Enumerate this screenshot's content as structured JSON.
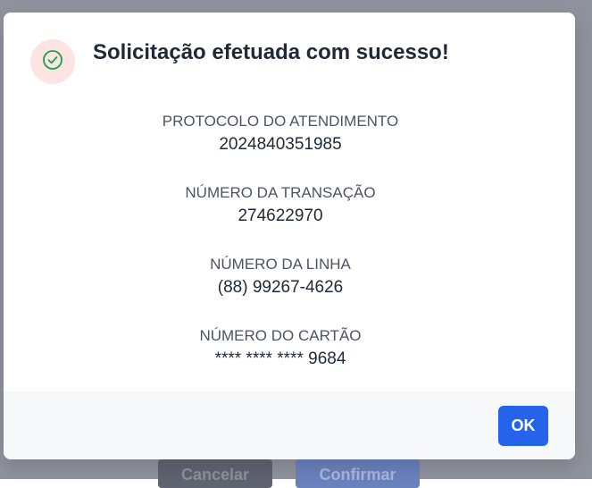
{
  "background": {
    "cancel_label": "Cancelar",
    "confirm_label": "Confirmar"
  },
  "dialog": {
    "icon": "check-circle-icon",
    "title": "Solicitação efetuada com sucesso!",
    "fields": [
      {
        "label": "PROTOCOLO DO ATENDIMENTO",
        "value": "2024840351985"
      },
      {
        "label": "NÚMERO DA TRANSAÇÃO",
        "value": "274622970"
      },
      {
        "label": "NÚMERO DA LINHA",
        "value": "(88) 99267-4626"
      },
      {
        "label": "NÚMERO DO CARTÃO",
        "value": "**** **** **** 9684"
      }
    ],
    "ok_label": "OK"
  },
  "colors": {
    "overlay": "#8f939d",
    "accent": "#2563eb",
    "success_icon": "#16a34a",
    "icon_bg": "#fde4e2"
  }
}
